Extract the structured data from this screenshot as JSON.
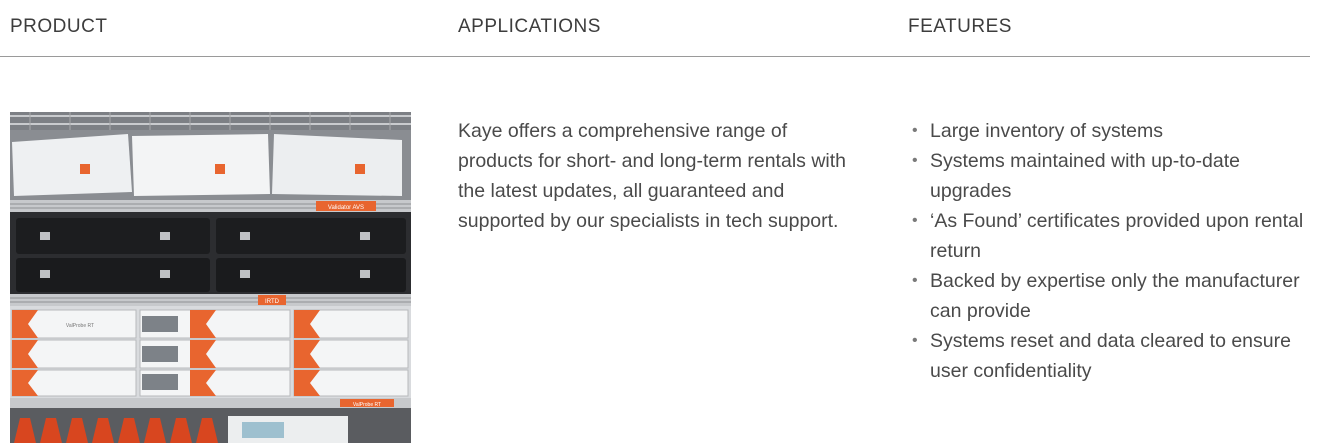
{
  "headers": {
    "product": "PRODUCT",
    "applications": "APPLICATIONS",
    "features": "FEATURES"
  },
  "product": {
    "image_labels": {
      "top_shelf": "Validator AVS",
      "middle_shelf": "IRTD",
      "bottom_box": "ValProbe RT",
      "bottom_shelf": "ValProbe RT"
    }
  },
  "applications": {
    "text": "Kaye offers a comprehensive range of products for short- and long-term rentals with the latest updates, all guaranteed and supported by our specialists in tech support."
  },
  "features": {
    "items": [
      "Large inventory of systems",
      "Systems maintained with up-to-date upgrades",
      "‘As Found’ certificates provided upon rental return",
      "Backed by expertise only the manufacturer can provide",
      "Systems reset and data cleared to ensure user confidentiality"
    ]
  },
  "colors": {
    "accent_orange": "#e8652f",
    "text": "#4a4a4a",
    "rule": "#9a9a9a"
  }
}
